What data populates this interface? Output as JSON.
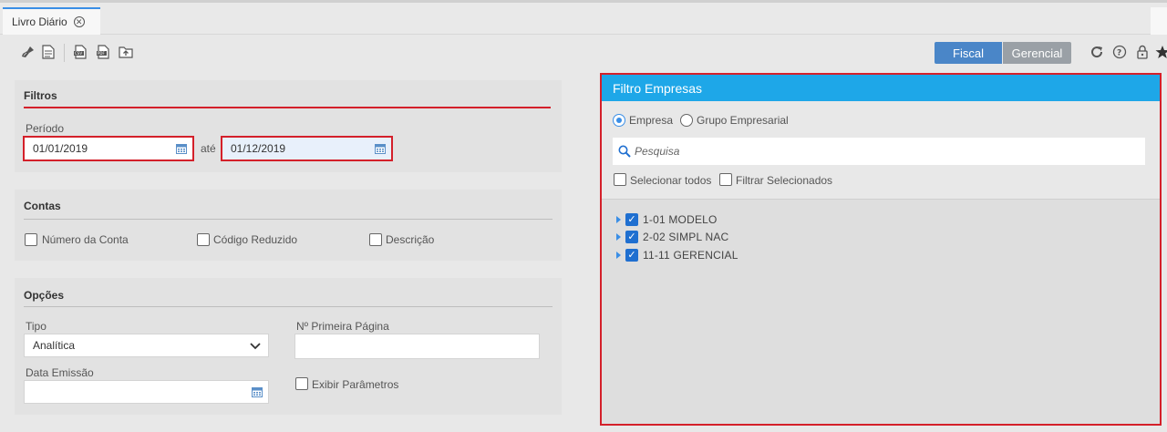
{
  "tab": {
    "title": "Livro Diário",
    "close_icon": "close-circle-icon"
  },
  "toolbar": {
    "icons": [
      "broom-icon",
      "document-icon",
      "csv-export-icon",
      "pdf-export-icon",
      "upload-folder-icon"
    ],
    "segment_fiscal": "Fiscal",
    "segment_gerencial": "Gerencial",
    "right_icons": [
      "refresh-icon",
      "help-icon",
      "lock-icon",
      "star-icon"
    ]
  },
  "filtros": {
    "title": "Filtros",
    "periodo_label": "Período",
    "date_from": "01/01/2019",
    "ate_label": "até",
    "date_to": "01/12/2019"
  },
  "contas": {
    "title": "Contas",
    "options": [
      "Número da Conta",
      "Código Reduzido",
      "Descrição"
    ]
  },
  "opcoes": {
    "title": "Opções",
    "tipo_label": "Tipo",
    "tipo_value": "Analítica",
    "primeira_pagina_label": "Nº Primeira Página",
    "primeira_pagina_value": "",
    "data_emissao_label": "Data Emissão",
    "data_emissao_value": "",
    "exibir_parametros_label": "Exibir Parâmetros"
  },
  "filtro_empresas": {
    "title": "Filtro Empresas",
    "radio_empresa": "Empresa",
    "radio_grupo": "Grupo Empresarial",
    "search_placeholder": "Pesquisa",
    "selecionar_todos": "Selecionar todos",
    "filtrar_selecionados": "Filtrar Selecionados",
    "items": [
      {
        "label": "1-01 MODELO",
        "checked": true
      },
      {
        "label": "2-02 SIMPL NAC",
        "checked": true
      },
      {
        "label": "11-11 GERENCIAL",
        "checked": true
      }
    ]
  },
  "colors": {
    "accent": "#1ea7e8",
    "highlight": "#d4202a",
    "segment_active": "#4a86c8",
    "checkbox": "#1f6fd0"
  }
}
